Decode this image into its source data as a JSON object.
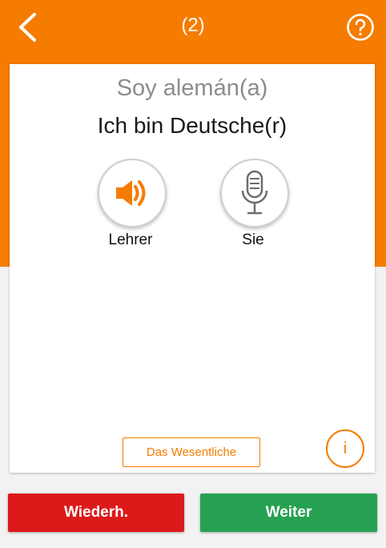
{
  "header": {
    "counter": "(2)",
    "back_icon": "chevron-left-icon",
    "help_icon": "question-circle-icon"
  },
  "card": {
    "source_phrase": "Soy alemán(a)",
    "target_phrase": "Ich bin Deutsche(r)",
    "teacher_button": {
      "icon": "speaker-icon",
      "label": "Lehrer"
    },
    "you_button": {
      "icon": "microphone-icon",
      "label": "Sie"
    },
    "essentials_label": "Das Wesentliche",
    "info_label": "i"
  },
  "footer": {
    "repeat_label": "Wiederh.",
    "next_label": "Weiter"
  },
  "colors": {
    "accent": "#f57c00",
    "repeat": "#dd1a1a",
    "next": "#26a152",
    "background": "#f2f2f2"
  }
}
